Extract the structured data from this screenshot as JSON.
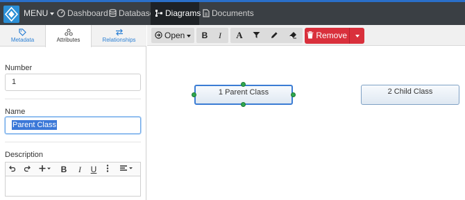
{
  "nav": {
    "menu_label": "MENU",
    "items": [
      {
        "label": "Dashboard",
        "icon": "dashboard-icon",
        "active": false
      },
      {
        "label": "Database",
        "icon": "database-icon",
        "active": false
      },
      {
        "label": "Diagrams",
        "icon": "diagrams-icon",
        "active": true
      },
      {
        "label": "Documents",
        "icon": "document-icon",
        "active": false
      }
    ],
    "accent_color": "#2a6fc9",
    "bar_color": "#3a3f44"
  },
  "left_panel": {
    "tabs": [
      {
        "label": "Metadata",
        "icon": "tag-icon",
        "active": false
      },
      {
        "label": "Attributes",
        "icon": "attributes-icon",
        "active": true
      },
      {
        "label": "Relationships",
        "icon": "arrows-icon",
        "active": false
      }
    ],
    "number": {
      "label": "Number",
      "value": "1"
    },
    "name": {
      "label": "Name",
      "value": "Parent Class"
    },
    "description": {
      "label": "Description",
      "value": ""
    },
    "rte_buttons": [
      "undo-icon",
      "redo-icon",
      "insert-icon",
      "bold-icon",
      "italic-icon",
      "underline-icon",
      "more-icon",
      "align-icon"
    ]
  },
  "toolbar": {
    "open_label": "Open",
    "remove_label": "Remove",
    "remove_color": "#d9303c",
    "format_buttons": [
      "bold-icon",
      "italic-icon",
      "font-color-icon",
      "filter-icon",
      "pencil-icon",
      "eraser-icon"
    ]
  },
  "diagram": {
    "nodes": [
      {
        "label": "1 Parent Class",
        "selected": true
      },
      {
        "label": "2 Child Class",
        "selected": false
      }
    ]
  }
}
